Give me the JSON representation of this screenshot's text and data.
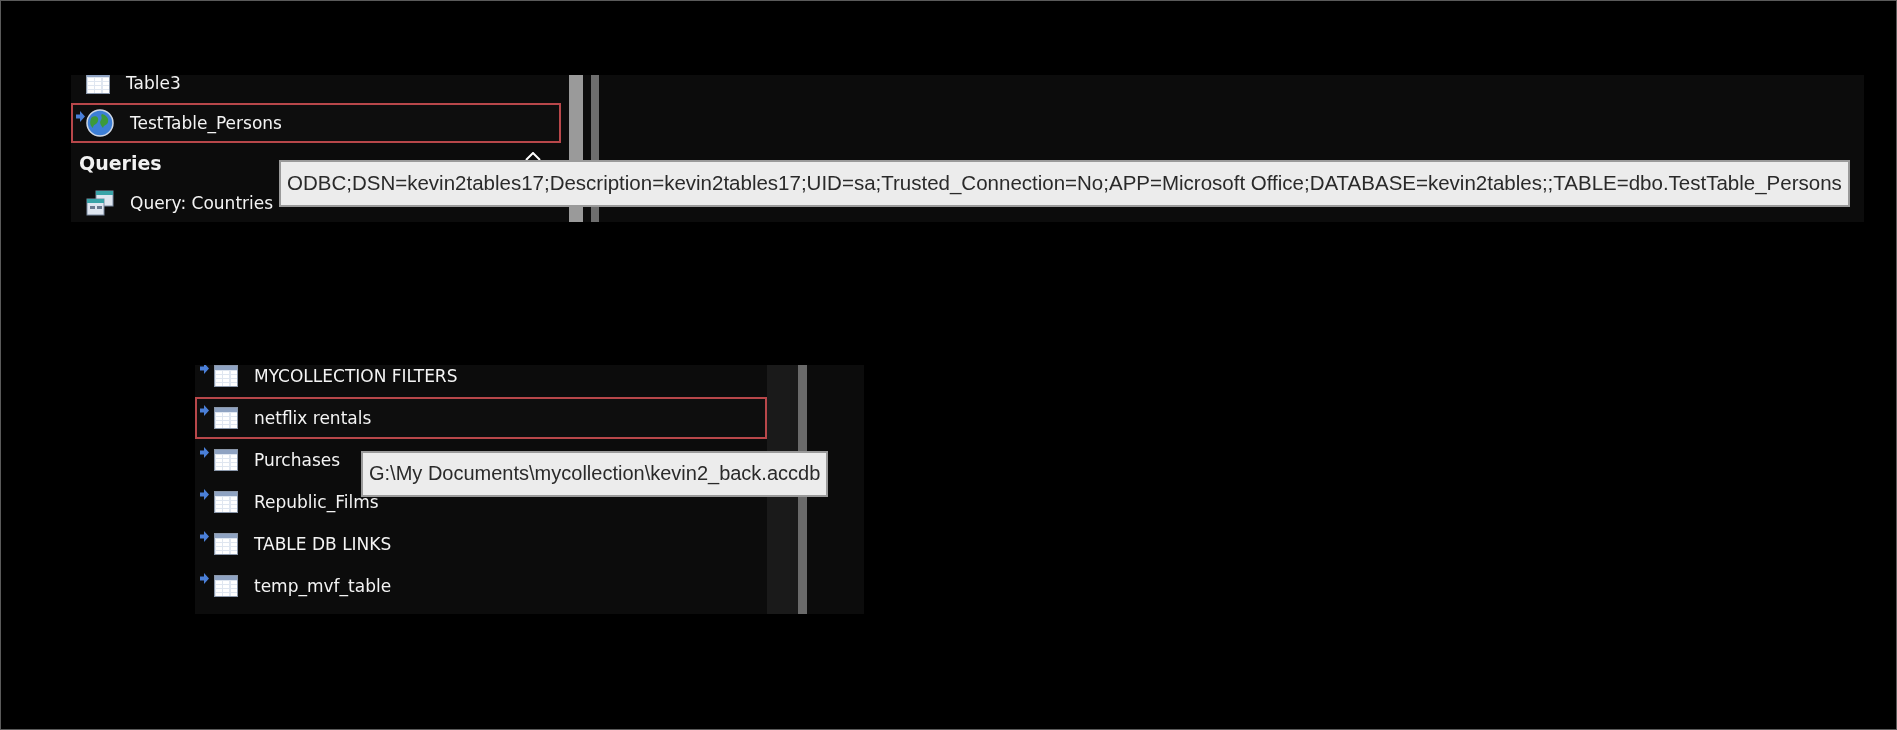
{
  "top_panel": {
    "items": [
      {
        "kind": "table",
        "label": "Table3",
        "linked": false,
        "selected": false
      },
      {
        "kind": "odbc",
        "label": "TestTable_Persons",
        "linked": true,
        "selected": true
      },
      {
        "kind": "header",
        "label": "Queries"
      },
      {
        "kind": "query",
        "label": "Query: Countries",
        "linked": false,
        "selected": false
      }
    ],
    "tooltip": "ODBC;DSN=kevin2tables17;Description=kevin2tables17;UID=sa;Trusted_Connection=No;APP=Microsoft Office;DATABASE=kevin2tables;;TABLE=dbo.TestTable_Persons"
  },
  "bottom_panel": {
    "items": [
      {
        "kind": "table",
        "label": "MYCOLLECTION FILTERS",
        "linked": true,
        "selected": false
      },
      {
        "kind": "table",
        "label": "netflix rentals",
        "linked": true,
        "selected": true
      },
      {
        "kind": "table",
        "label": "Purchases",
        "linked": true,
        "selected": false
      },
      {
        "kind": "table",
        "label": "Republic_Films",
        "linked": true,
        "selected": false
      },
      {
        "kind": "table",
        "label": "TABLE DB LINKS",
        "linked": true,
        "selected": false
      },
      {
        "kind": "table",
        "label": "temp_mvf_table",
        "linked": true,
        "selected": false
      }
    ],
    "tooltip": "G:\\My Documents\\mycollection\\kevin2_back.accdb"
  }
}
